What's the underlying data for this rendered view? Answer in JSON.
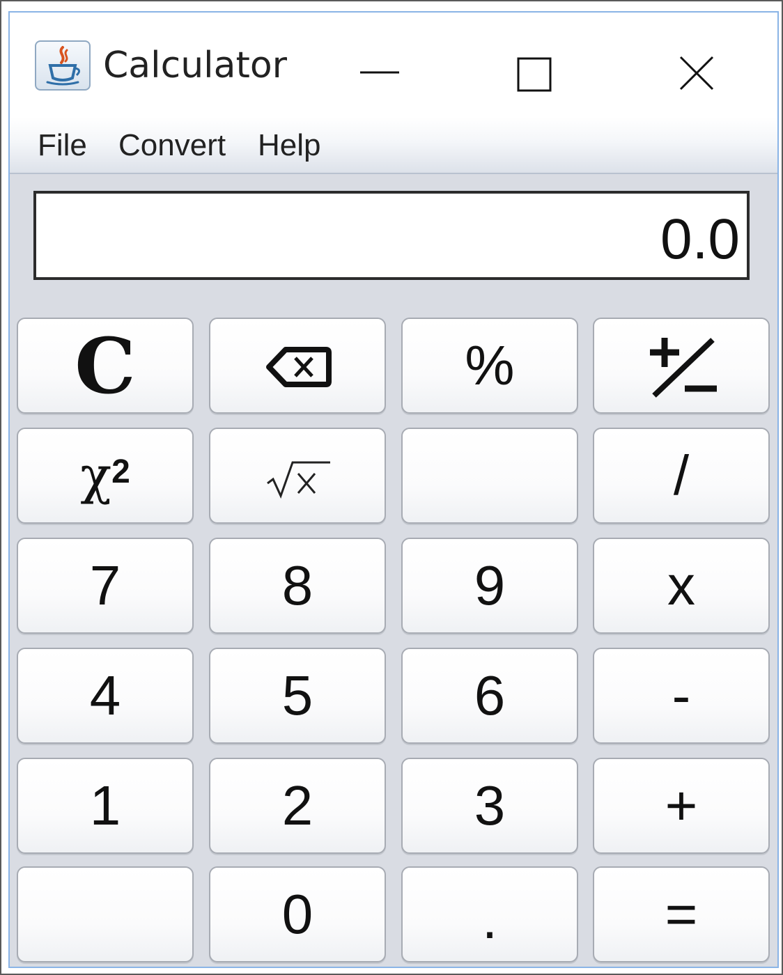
{
  "window": {
    "title": "Calculator",
    "app_icon": "java-coffee-icon",
    "controls": [
      "minimize-icon",
      "maximize-icon",
      "close-icon"
    ]
  },
  "menu": {
    "file": "File",
    "convert": "Convert",
    "help": "Help"
  },
  "display": {
    "value": "0.0"
  },
  "keys": {
    "clear": "C",
    "backspace_icon": "backspace-icon",
    "percent": "%",
    "plus_minus_icon": "plus-minus-icon",
    "square_base": "χ",
    "square_exp": "2",
    "sqrt_icon": "square-root-icon",
    "divide": "/",
    "seven": "7",
    "eight": "8",
    "nine": "9",
    "multiply": "x",
    "four": "4",
    "five": "5",
    "six": "6",
    "subtract": "-",
    "one": "1",
    "two": "2",
    "three": "3",
    "add": "+",
    "zero": "0",
    "decimal": ".",
    "equals": "="
  },
  "colors": {
    "window_border": "#8ab4e6",
    "panel_background": "#d9dce3",
    "key_border": "#a7abb3"
  }
}
